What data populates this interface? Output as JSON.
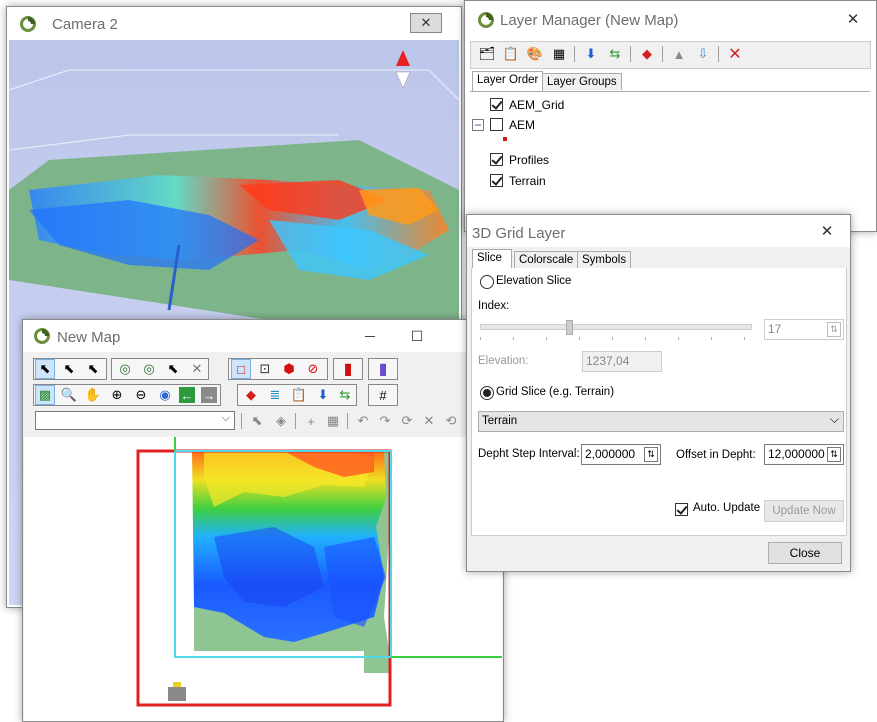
{
  "camera": {
    "title": "Camera 2",
    "close_glyph": "✕"
  },
  "layer_manager": {
    "title": "Layer Manager (New Map)",
    "close_glyph": "✕",
    "tabs": [
      "Layer Order",
      "Layer Groups"
    ],
    "layers": [
      {
        "name": "AEM_Grid",
        "checked": true
      },
      {
        "name": "AEM",
        "checked": false
      },
      {
        "name": "Profiles",
        "checked": true
      },
      {
        "name": "Terrain",
        "checked": true
      }
    ],
    "collapse_glyph": "−"
  },
  "grid_layer": {
    "title": "3D Grid Layer",
    "close_glyph": "✕",
    "tabs": [
      "Slice",
      "Colorscale",
      "Symbols"
    ],
    "elevation_slice_label": "Elevation Slice",
    "index_label": "Index:",
    "index_value": "17",
    "elevation_label": "Elevation:",
    "elevation_value": "1237,04",
    "grid_slice_label": "Grid Slice (e.g. Terrain)",
    "grid_select_value": "Terrain",
    "depth_step_label": "Depht Step Interval:",
    "depth_step_value": "2,000000",
    "offset_label": "Offset in Depht:",
    "offset_value": "12,000000",
    "auto_update_label": "Auto. Update",
    "update_now_label": "Update Now",
    "close_label": "Close"
  },
  "new_map": {
    "title": "New Map",
    "maximize_glyph": "☐"
  },
  "colors": {
    "selection": "#e02020",
    "extent": "#4fd8e8",
    "profile": "#3ccf3c"
  }
}
